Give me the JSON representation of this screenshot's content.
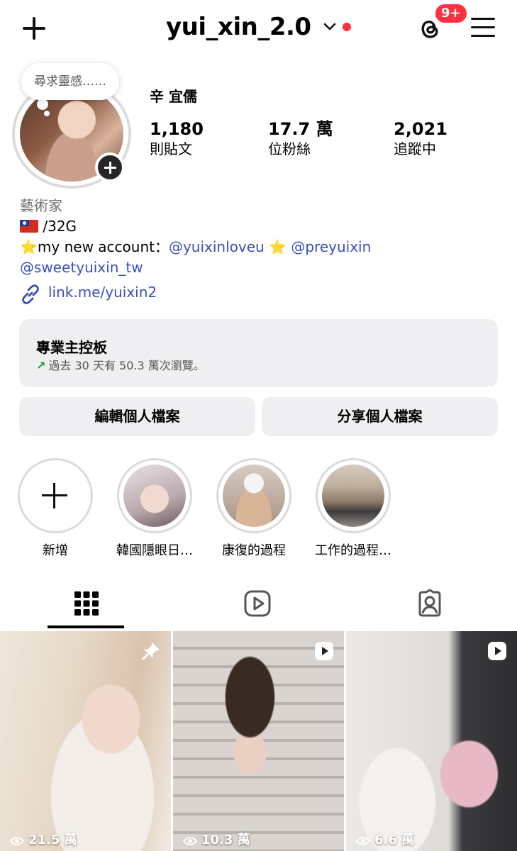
{
  "header": {
    "username": "yui_xin_2.0",
    "notification_badge": "9+"
  },
  "profile": {
    "note": "尋求靈感……",
    "full_name": "辛 宜儒",
    "stats": [
      {
        "value": "1,180",
        "label": "則貼文"
      },
      {
        "value": "17.7 萬",
        "label": "位粉絲"
      },
      {
        "value": "2,021",
        "label": "追蹤中"
      }
    ],
    "category": "藝術家",
    "bio_line1_text": "/32G",
    "bio_line2_prefix": "my new account：",
    "bio_line2_mention1": "@yuixinloveu",
    "bio_line2_mention2": "@preyuixin",
    "bio_line3_mention": "@sweetyuixin_tw",
    "link": "link.me/yuixin2"
  },
  "dashboard": {
    "title": "專業主控板",
    "subtitle": "過去 30 天有 50.3 萬次瀏覽。"
  },
  "buttons": {
    "edit": "編輯個人檔案",
    "share": "分享個人檔案"
  },
  "highlights": [
    {
      "label": "新增"
    },
    {
      "label": "韓國隱眼日…"
    },
    {
      "label": "康復的過程"
    },
    {
      "label": "工作的過程…"
    }
  ],
  "tabs": [
    "grid-icon",
    "reels-icon",
    "tagged-icon"
  ],
  "posts": [
    {
      "views": "21.5 萬",
      "badge": "pin-icon"
    },
    {
      "views": "10.3 萬",
      "badge": "reel-icon"
    },
    {
      "views": "6.6 萬",
      "badge": "reel-icon"
    }
  ],
  "colors": {
    "accent_red": "#ff3040",
    "link_blue": "#3b4fb8",
    "surface_gray": "#efeff1"
  }
}
